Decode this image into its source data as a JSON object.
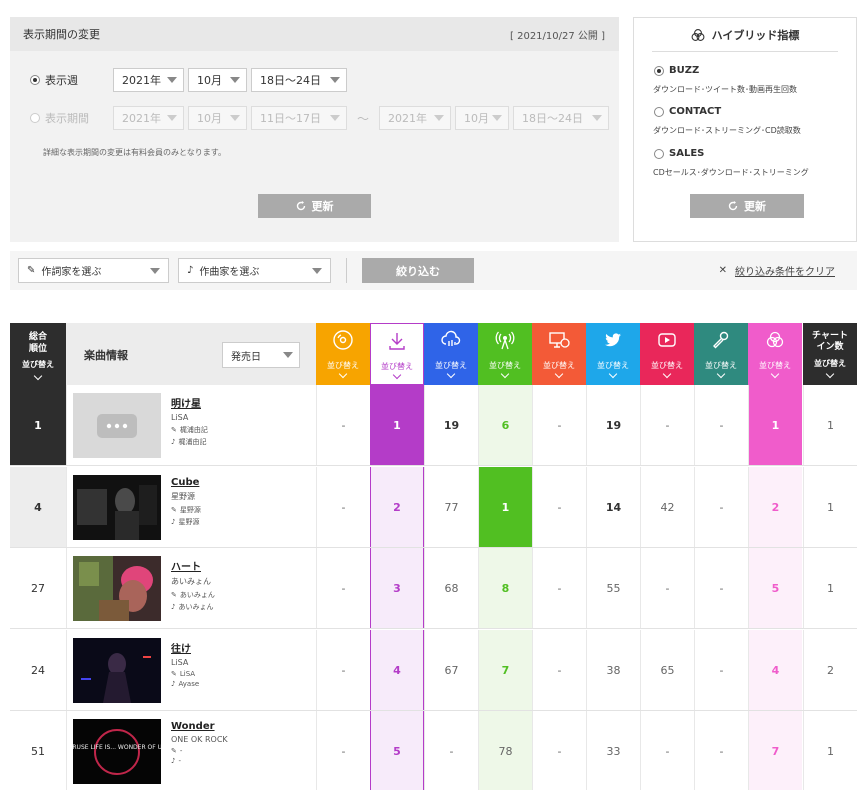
{
  "period_panel": {
    "title": "表示期間の変更",
    "published": "[ 2021/10/27 公開 ]",
    "week_label": "表示週",
    "week": {
      "year": "2021年",
      "month": "10月",
      "range": "18日〜24日"
    },
    "range_label": "表示期間",
    "from": {
      "year": "2021年",
      "month": "10月",
      "range": "11日〜17日"
    },
    "tilde": "〜",
    "to": {
      "year": "2021年",
      "month": "10月",
      "range": "18日〜24日"
    },
    "note": "詳細な表示期間の変更は有料会員のみとなります。",
    "update_label": "更新"
  },
  "hybrid_panel": {
    "title": "ハイブリッド指標",
    "options": [
      {
        "name": "BUZZ",
        "desc": "ダウンロード･ツイート数･動画再生回数",
        "selected": true
      },
      {
        "name": "CONTACT",
        "desc": "ダウンロード･ストリーミング･CD読取数",
        "selected": false
      },
      {
        "name": "SALES",
        "desc": "CDセールス･ダウンロード･ストリーミング",
        "selected": false
      }
    ],
    "update_label": "更新"
  },
  "filter": {
    "lyricist_label": "作詞家を選ぶ",
    "composer_label": "作曲家を選ぶ",
    "apply_label": "絞り込む",
    "clear_label": "絞り込み条件をクリア"
  },
  "table": {
    "rank_header": [
      "総合",
      "順位"
    ],
    "sort_label": "並び替え",
    "info_header": "楽曲情報",
    "release_sort": "発売日",
    "last_header": [
      "チャート",
      "イン数"
    ],
    "source_colors": [
      "#f7a400",
      "#b43cc8",
      "#2f64e8",
      "#51bf22",
      "#f35a37",
      "#1ea7ea",
      "#e9275a",
      "#2f8a7f",
      "#f05ccb"
    ],
    "source_icons": [
      "cd-icon",
      "download-icon",
      "streaming-icon",
      "radio-icon",
      "pc-reading-icon",
      "twitter-icon",
      "video-icon",
      "karaoke-icon",
      "hybrid-icon"
    ],
    "rows": [
      {
        "rank": "1",
        "song": "明け星",
        "artist": "LiSA",
        "lyricist": "梶浦由記",
        "composer": "梶浦由記",
        "values": [
          "-",
          "1",
          "19",
          "6",
          "-",
          "19",
          "-",
          "-",
          "1"
        ],
        "chart_in": "1"
      },
      {
        "rank": "4",
        "song": "Cube",
        "artist": "星野源",
        "lyricist": "星野源",
        "composer": "星野源",
        "values": [
          "-",
          "2",
          "77",
          "1",
          "-",
          "14",
          "42",
          "-",
          "2"
        ],
        "chart_in": "1"
      },
      {
        "rank": "27",
        "song": "ハート",
        "artist": "あいみょん",
        "lyricist": "あいみょん",
        "composer": "あいみょん",
        "values": [
          "-",
          "3",
          "68",
          "8",
          "-",
          "55",
          "-",
          "-",
          "5"
        ],
        "chart_in": "1"
      },
      {
        "rank": "24",
        "song": "往け",
        "artist": "LiSA",
        "lyricist": "LiSA",
        "composer": "Ayase",
        "values": [
          "-",
          "4",
          "67",
          "7",
          "-",
          "38",
          "65",
          "-",
          "4"
        ],
        "chart_in": "2"
      },
      {
        "rank": "51",
        "song": "Wonder",
        "artist": "ONE OK ROCK",
        "lyricist": "-",
        "composer": "-",
        "values": [
          "-",
          "5",
          "-",
          "78",
          "-",
          "33",
          "-",
          "-",
          "7"
        ],
        "chart_in": "1",
        "thumb_text": "CRUSE LIFE IS... WONDER OF US"
      }
    ]
  }
}
